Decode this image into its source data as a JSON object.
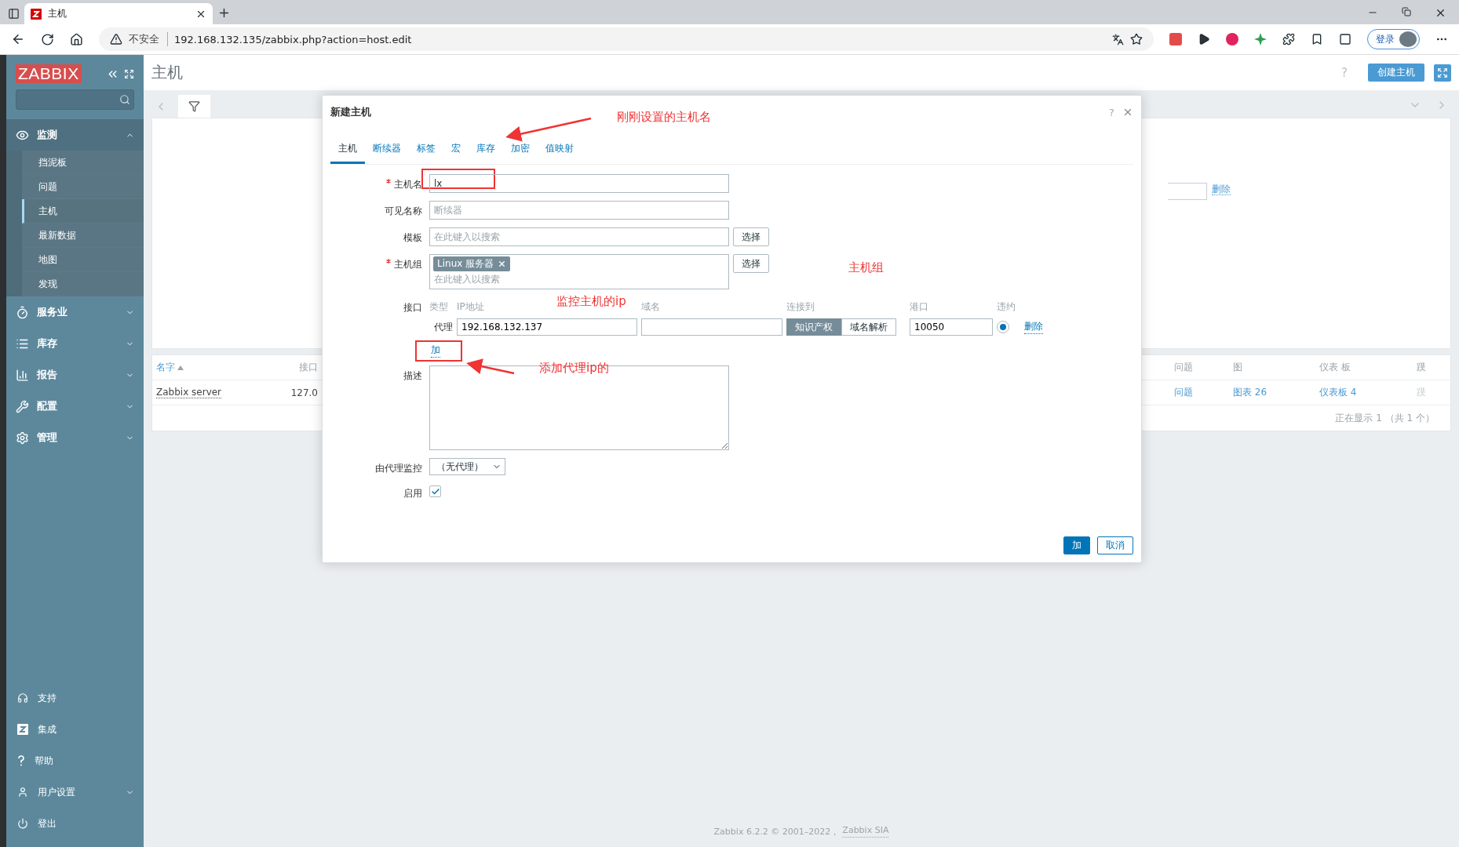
{
  "browser": {
    "tab_title": "主机",
    "security": "不安全",
    "url": "192.168.132.135/zabbix.php?action=host.edit",
    "profile_button": "登录"
  },
  "sidebar": {
    "logo": "ZABBIX",
    "menu": [
      {
        "label": "监测",
        "expanded": true,
        "children": [
          {
            "label": "挡泥板",
            "selected": false
          },
          {
            "label": "问题",
            "selected": false
          },
          {
            "label": "主机",
            "selected": true
          },
          {
            "label": "最新数据",
            "selected": false
          },
          {
            "label": "地图",
            "selected": false
          },
          {
            "label": "发现",
            "selected": false
          }
        ]
      },
      {
        "label": "服务业",
        "expanded": false
      },
      {
        "label": "库存",
        "expanded": false
      },
      {
        "label": "报告",
        "expanded": false
      },
      {
        "label": "配置",
        "expanded": false
      },
      {
        "label": "管理",
        "expanded": false
      }
    ],
    "bottom_menu": [
      {
        "label": "支持"
      },
      {
        "label": "集成"
      },
      {
        "label": "帮助"
      },
      {
        "label": "用户设置",
        "expanded": false
      },
      {
        "label": "登出"
      }
    ]
  },
  "page": {
    "title": "主机",
    "help": "?",
    "create_button": "创建主机",
    "filter_remove": "删除"
  },
  "table": {
    "columns": [
      {
        "label": "名字",
        "sorted": true
      },
      {
        "label": "接口"
      },
      {
        "label": "问题"
      },
      {
        "label": "图"
      },
      {
        "label": "仪表 板"
      },
      {
        "label": "蹼"
      }
    ],
    "rows": [
      {
        "cells": [
          {
            "text": "Zabbix server",
            "kind": "name"
          },
          {
            "text": "127.0",
            "kind": "text"
          },
          {
            "text": "问题",
            "kind": "link"
          },
          {
            "text": "图表 26",
            "kind": "link"
          },
          {
            "text": "仪表板 4",
            "kind": "link"
          },
          {
            "text": "蹼",
            "kind": "disabled"
          }
        ]
      }
    ],
    "pager": "正在显示 1 （共 1 个）"
  },
  "dialog": {
    "title": "新建主机",
    "help": "?",
    "tabs": [
      {
        "label": "主机",
        "selected": true
      },
      {
        "label": "断续器",
        "selected": false
      },
      {
        "label": "标签",
        "selected": false
      },
      {
        "label": "宏",
        "selected": false
      },
      {
        "label": "库存",
        "selected": false
      },
      {
        "label": "加密",
        "selected": false
      },
      {
        "label": "值映射",
        "selected": false
      }
    ],
    "host_name": {
      "label": "主机名",
      "required": true,
      "value": "lx"
    },
    "visible_name": {
      "label": "可见名称",
      "placeholder": "断续器"
    },
    "templates": {
      "label": "模板",
      "placeholder": "在此键入以搜索",
      "button": "选择"
    },
    "host_groups": {
      "label": "主机组",
      "required": true,
      "tags": [
        "Linux 服务器"
      ],
      "placeholder": "在此键入以搜索",
      "button": "选择"
    },
    "interfaces": {
      "label": "接口",
      "columns": [
        "类型",
        "IP地址",
        "域名",
        "连接到",
        "港口",
        "违约"
      ],
      "rows": [
        {
          "type": "代理",
          "ip": "192.168.132.137",
          "connect_to": [
            {
              "label": "知识产权",
              "selected": true
            },
            {
              "label": "域名解析",
              "selected": false
            }
          ],
          "port": "10050",
          "default": true,
          "remove": "删除"
        }
      ],
      "add_link": "加"
    },
    "description": {
      "label": "描述"
    },
    "proxy": {
      "label": "由代理监控",
      "value": "（无代理）"
    },
    "enabled": {
      "label": "启用",
      "checked": true
    },
    "buttons": [
      {
        "label": "加",
        "primary": true
      },
      {
        "label": "取消",
        "primary": false
      }
    ]
  },
  "annotations": [
    "刚刚设置的主机名",
    "主机组",
    "监控主机的ip",
    "添加代理ip的"
  ],
  "footer": {
    "text": "Zabbix 6.2.2 © 2001–2022，",
    "link": "Zabbix SIA"
  }
}
